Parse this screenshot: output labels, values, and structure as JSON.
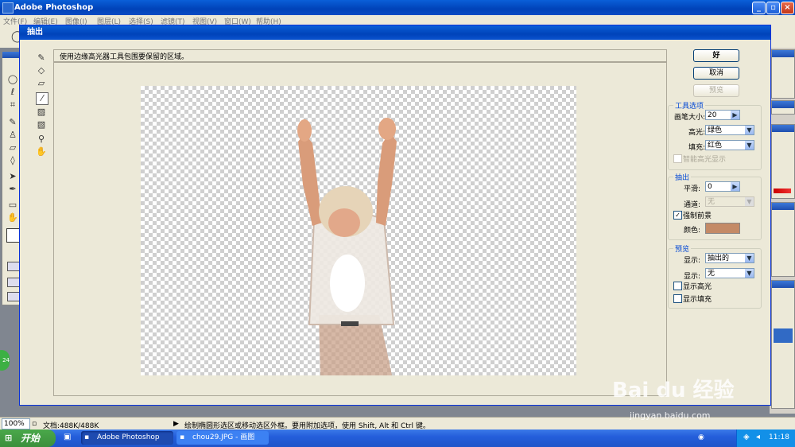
{
  "app": {
    "title": "Adobe Photoshop"
  },
  "menu": [
    "文件(F)",
    "编辑(E)",
    "图像(I)",
    "图层(L)",
    "选择(S)",
    "滤镜(T)",
    "视图(V)",
    "窗口(W)",
    "帮助(H)"
  ],
  "dialog": {
    "title": "抽出",
    "hint": "使用边缘高光器工具包围要保留的区域。",
    "buttons": {
      "ok": "好",
      "cancel": "取消",
      "preview": "预览"
    },
    "tool_options": {
      "group": "工具选项",
      "brush_size_label": "画笔大小:",
      "brush_size_value": "20",
      "highlight_label": "高光:",
      "highlight_value": "绿色",
      "fill_label": "填充:",
      "fill_value": "红色",
      "smart_highlight": "智能高光显示"
    },
    "extraction": {
      "group": "抽出",
      "smooth_label": "平滑:",
      "smooth_value": "0",
      "channel_label": "通道:",
      "channel_value": "无",
      "force_fg": "强制前景",
      "color_label": "颜色:",
      "color_swatch": "#c48a66"
    },
    "preview": {
      "group": "预览",
      "show_label": "显示:",
      "show_value": "抽出的",
      "show2_label": "显示:",
      "show2_value": "无",
      "show_highlight": "显示高光",
      "show_fill": "显示填充"
    }
  },
  "status": {
    "zoom": "100%",
    "doc": "文档:488K/488K",
    "hint": "绘制椭圆形选区或移动选区外框。要用附加选项，使用 Shift, Alt 和 Ctrl 键。"
  },
  "taskbar": {
    "start": "开始",
    "tasks": [
      "Adobe Photoshop",
      "chou29.JPG - 画图"
    ],
    "clock": "11:18"
  },
  "watermark": {
    "brand": "Bai du 经验",
    "url": "jingyan.baidu.com"
  }
}
